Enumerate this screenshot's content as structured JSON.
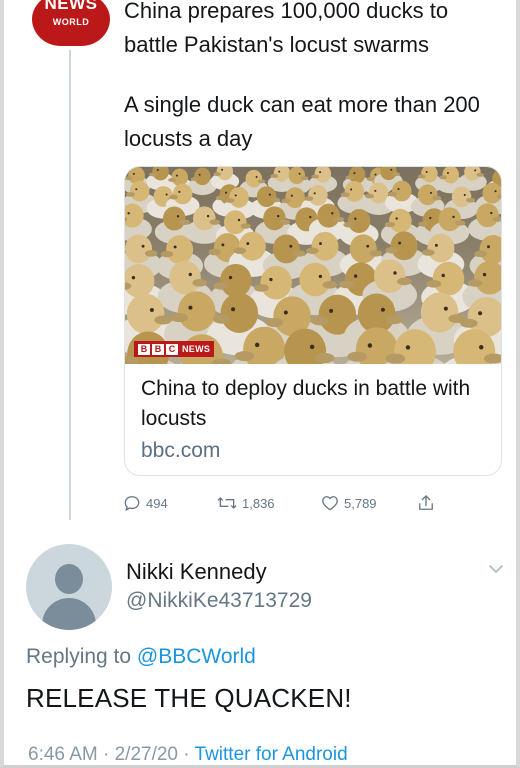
{
  "quoted_tweet": {
    "logo": {
      "line1": "NEWS",
      "line2": "WORLD",
      "color": "#bb1919"
    },
    "text_line1": "China prepares 100,000 ducks to battle Pakistan's locust swarms",
    "text_line2": "A single duck can eat more than 200 locusts a day",
    "card": {
      "image_badge": "NEWS",
      "title": "China to deploy ducks in battle with locusts",
      "domain": "bbc.com"
    },
    "actions": {
      "replies": "494",
      "retweets": "1,836",
      "likes": "5,789"
    }
  },
  "reply_tweet": {
    "name": "Nikki Kennedy",
    "handle": "@NikkiKe43713729",
    "replying_prefix": "Replying to",
    "replying_mention": "@BBCWorld",
    "text": "RELEASE THE QUACKEN!",
    "time": "6:46 AM · 2/27/20 ·",
    "app": "Twitter for Android"
  },
  "colors": {
    "link": "#1b95e0",
    "secondary_text": "#657786",
    "bbc_red": "#bb1919"
  }
}
